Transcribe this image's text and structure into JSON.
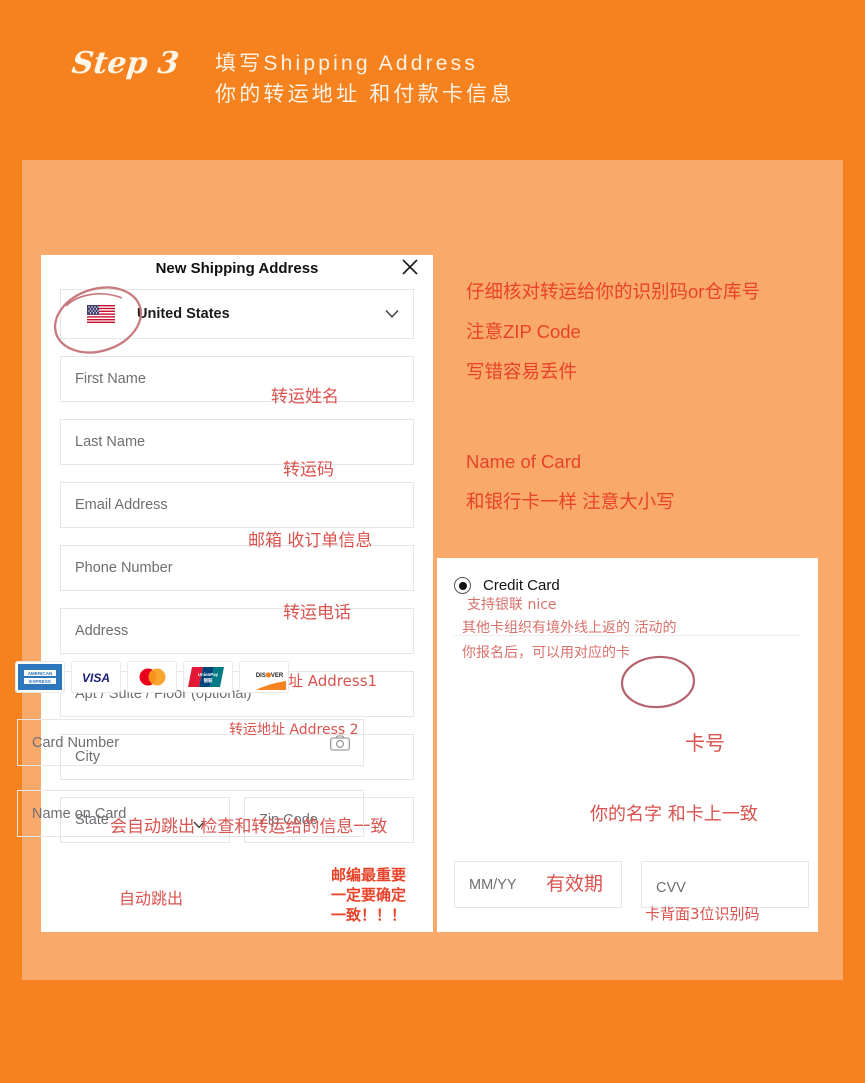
{
  "header": {
    "step_badge": "Step 3",
    "line1": "填写Shipping Address",
    "line2": "你的转运地址 和付款卡信息"
  },
  "colors": {
    "page_orange": "#F6821F",
    "stage_peach": "#F9A96A",
    "note_red": "#E8432A",
    "hand_red": "#D9534F",
    "hand_soft_red": "#D8716B",
    "panel_white": "#FFFFFF",
    "label_gray": "#6E6E73"
  },
  "shipping_form": {
    "title": "New Shipping Address",
    "close_icon": "close-icon",
    "country": {
      "flag_icon": "us-flag-icon",
      "value": "United States",
      "chevron_icon": "chevron-down-icon"
    },
    "fields": [
      {
        "label": "First Name",
        "annotation": "转运姓名"
      },
      {
        "label": "Last Name",
        "annotation": "转运码"
      },
      {
        "label": "Email Address",
        "annotation": "邮箱 收订单信息"
      },
      {
        "label": "Phone Number",
        "annotation": "转运电话"
      },
      {
        "label": "Address",
        "annotation": "转运地址 Address1"
      },
      {
        "label": "Apt / Suite / Floor (optional)",
        "annotation": "转运地址 Address 2"
      },
      {
        "label": "City",
        "annotation": "会自动跳出 检查和转运给的信息一致"
      }
    ],
    "state": {
      "label": "State",
      "annotation": "自动跳出",
      "chevron_icon": "chevron-down-icon"
    },
    "zip": {
      "label": "Zip Code"
    },
    "zip_warning": [
      "邮编最重要",
      "一定要确定",
      "一致！！！"
    ]
  },
  "notes": {
    "block1": [
      "仔细核对转运给你的识别码or仓库号",
      "注意ZIP Code",
      "写错容易丢件"
    ],
    "block2": [
      "Name of Card",
      "和银行卡一样 注意大小写"
    ]
  },
  "credit_card": {
    "radio_label": "Credit Card",
    "radio_selected": true,
    "annotations": [
      "支持银联 nice",
      "其他卡组织有境外线上返的 活动的",
      "你报名后，可以用对应的卡"
    ],
    "brands": [
      {
        "name": "American Express",
        "icon": "amex-icon"
      },
      {
        "name": "VISA",
        "icon": "visa-icon"
      },
      {
        "name": "Mastercard",
        "icon": "mastercard-icon"
      },
      {
        "name": "UnionPay",
        "icon": "unionpay-icon"
      },
      {
        "name": "Discover",
        "icon": "discover-icon"
      }
    ],
    "fields": {
      "card_number": {
        "label": "Card Number",
        "annotation": "卡号",
        "camera_icon": "camera-icon"
      },
      "name_on_card": {
        "label": "Name on Card",
        "annotation": "你的名字 和卡上一致"
      },
      "expiry": {
        "label": "MM/YY",
        "annotation": "有效期"
      },
      "cvv": {
        "label": "CVV",
        "annotation": "卡背面3位识别码"
      }
    }
  }
}
